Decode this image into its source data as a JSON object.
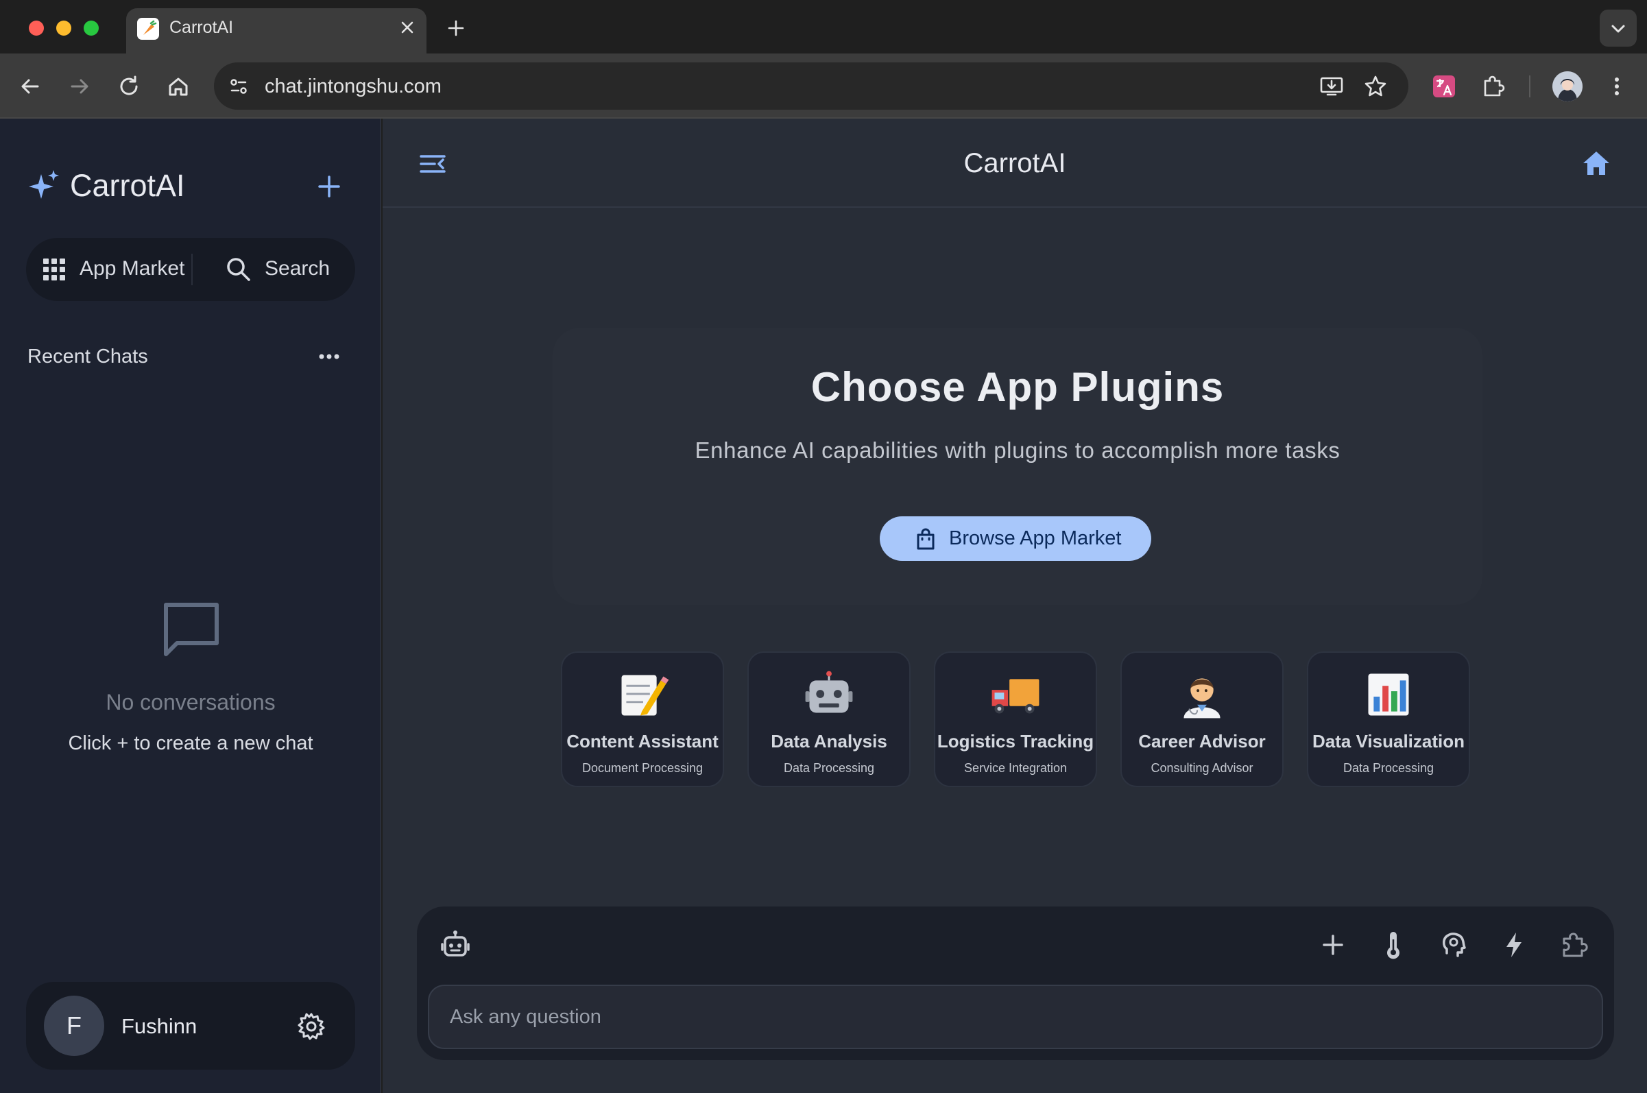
{
  "browser": {
    "tab_title": "CarrotAI",
    "url": "chat.jintongshu.com"
  },
  "sidebar": {
    "brand": "CarrotAI",
    "app_market_label": "App Market",
    "search_label": "Search",
    "recent_title": "Recent Chats",
    "empty_title": "No conversations",
    "empty_hint": "Click + to create a new chat",
    "user": {
      "initial": "F",
      "name": "Fushinn"
    }
  },
  "main": {
    "title": "CarrotAI",
    "hero_title": "Choose App Plugins",
    "hero_subtitle": "Enhance AI capabilities with plugins to accomplish more tasks",
    "browse_label": "Browse App Market",
    "plugins": [
      {
        "emoji": "📝",
        "title": "Content Assistant",
        "category": "Document Processing"
      },
      {
        "emoji": "🤖",
        "title": "Data Analysis",
        "category": "Data Processing"
      },
      {
        "emoji": "🚚",
        "title": "Logistics Tracking",
        "category": "Service Integration"
      },
      {
        "emoji": "👨‍⚕️",
        "title": "Career Advisor",
        "category": "Consulting Advisor"
      },
      {
        "emoji": "📊",
        "title": "Data Visualization",
        "category": "Data Processing"
      }
    ],
    "composer": {
      "placeholder": "Ask any question"
    }
  },
  "icons": {
    "back": "arrow-left-icon",
    "forward": "arrow-right-icon",
    "reload": "reload-icon",
    "home": "home-icon",
    "install": "install-app-icon",
    "bookmark": "star-icon",
    "translate": "translate-icon",
    "extensions": "puzzle-icon",
    "menu": "kebab-icon",
    "brand": "sparkle-icon",
    "new_chat": "plus-icon",
    "market": "grid-icon",
    "search": "search-icon",
    "empty": "chat-bubble-icon",
    "settings": "gear-icon",
    "collapse": "collapse-sidebar-icon",
    "bag": "shopping-bag-icon",
    "bot": "robot-icon",
    "temperature": "thermometer-icon",
    "brain": "brain-icon",
    "bolt": "lightning-icon",
    "plugin": "puzzle-icon"
  },
  "colors": {
    "accent": "#a8c7fa",
    "sidebar_bg": "#1d2230",
    "main_bg": "#282d37",
    "traffic_red": "#ff5f57",
    "traffic_yellow": "#febc2e",
    "traffic_green": "#28c840"
  }
}
